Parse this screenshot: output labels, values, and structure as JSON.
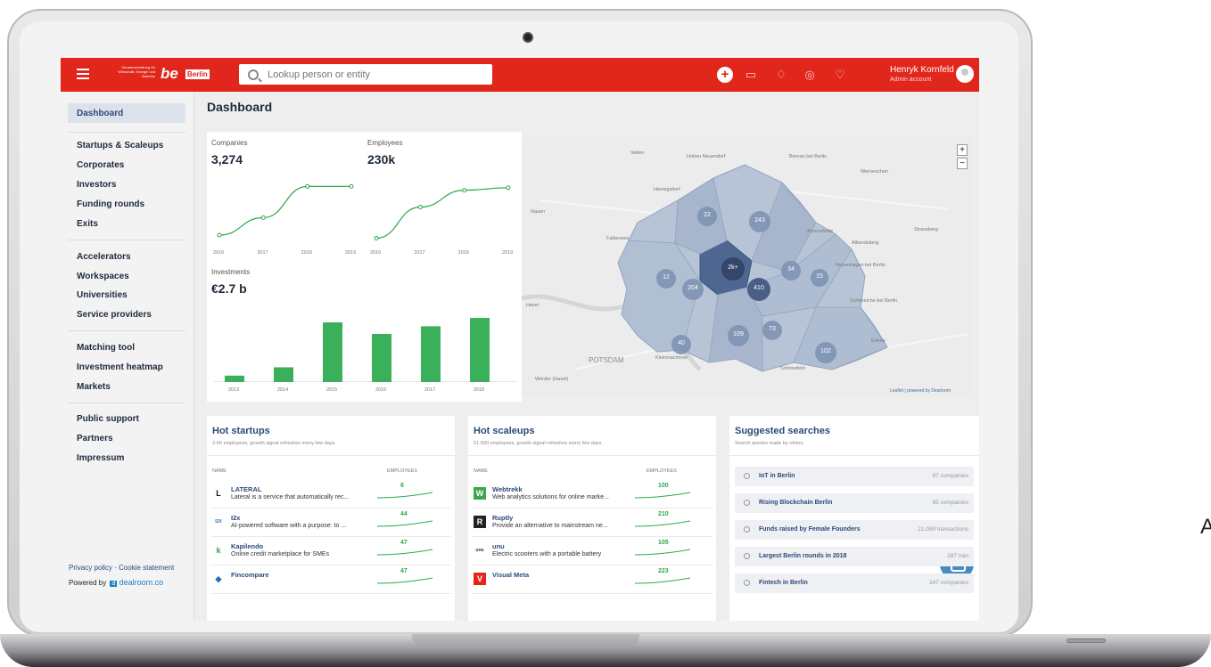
{
  "header": {
    "senate_text": "Senatsverwaltung für Wirtschaft, Energie und Betriebe",
    "logo_be": "be",
    "logo_berlin": "Berlin",
    "search_placeholder": "Lookup person or entity",
    "user_name": "Henryk Kornfeld",
    "user_role": "Admin account",
    "accent_color": "#e1261c"
  },
  "sidebar": {
    "active": "Dashboard",
    "group1": [
      "Startups & Scaleups",
      "Corporates",
      "Investors",
      "Funding rounds",
      "Exits"
    ],
    "group2": [
      "Accelerators",
      "Workspaces",
      "Universities",
      "Service providers"
    ],
    "group3": [
      "Matching tool",
      "Investment heatmap",
      "Markets"
    ],
    "group4": [
      "Public support",
      "Partners",
      "Impressum"
    ],
    "footer_links": "Privacy policy · Cookie statement",
    "powered_by": "Powered by",
    "powered_brand": "dealroom.co"
  },
  "main": {
    "title": "Dashboard",
    "companies": {
      "label": "Companies",
      "value": "3,274"
    },
    "employees": {
      "label": "Employees",
      "value": "230k"
    },
    "investments": {
      "label": "Investments",
      "value": "€2.7 b"
    }
  },
  "chart_data": [
    {
      "type": "line",
      "title": "Companies",
      "x": [
        "2016",
        "2017",
        "2018",
        "2019"
      ],
      "values": [
        0.1,
        0.38,
        0.88,
        0.88
      ],
      "color": "#2aa84a"
    },
    {
      "type": "line",
      "title": "Employees",
      "x": [
        "2016",
        "2017",
        "2018",
        "2019"
      ],
      "values": [
        0.05,
        0.55,
        0.82,
        0.86
      ],
      "color": "#2aa84a"
    },
    {
      "type": "bar",
      "title": "Investments",
      "categories": [
        "2013",
        "2014",
        "2015",
        "2016",
        "2017",
        "2018"
      ],
      "values": [
        0.1,
        0.23,
        0.93,
        0.75,
        0.87,
        1.0
      ],
      "color": "#3bb05a"
    }
  ],
  "map": {
    "clusters": [
      "22",
      "243",
      "2k+",
      "34",
      "15",
      "12",
      "204",
      "410",
      "109",
      "73",
      "40",
      "102"
    ],
    "place_labels": [
      "Velten",
      "Hohen Neuendorf",
      "Bernau bei Berlin",
      "Hennigsdorf",
      "Werneuchen",
      "Nauen",
      "Falkensee",
      "Ahrensfelde",
      "Altlandsberg",
      "Strausberg",
      "Neuenhagen bei Berlin",
      "Schöneiche bei Berlin",
      "Havel",
      "POTSDAM",
      "Kleinmachnow",
      "Schönefeld",
      "Werder (Havel)",
      "Erkner"
    ],
    "attribution": "Leaflet | powered by Dealroom",
    "zoom_in": "+",
    "zoom_out": "−"
  },
  "hot_startups": {
    "title": "Hot startups",
    "subtitle": "2-50 employees, growth signal refreshes every few days.",
    "col_name": "NAME",
    "col_employees": "EMPLOYEES",
    "rows": [
      {
        "logo": "L",
        "name": "LATERAL",
        "desc": "Lateral is a service that automatically rec...",
        "employees": "6"
      },
      {
        "logo": "I2X",
        "name": "I2x",
        "desc": "AI-powered software with a purpose: to ...",
        "employees": "44"
      },
      {
        "logo": "k",
        "name": "Kapilendo",
        "desc": "Online credit marketplace for SMEs",
        "employees": "47"
      },
      {
        "logo": "◆",
        "name": "Fincompare",
        "desc": "",
        "employees": "47"
      }
    ]
  },
  "hot_scaleups": {
    "title": "Hot scaleups",
    "subtitle": "51-500 employees, growth signal refreshes every few days.",
    "col_name": "NAME",
    "col_employees": "EMPLOYEES",
    "rows": [
      {
        "logo": "W",
        "name": "Webtrekk",
        "desc": "Web analytics solutions for online marke...",
        "employees": "100"
      },
      {
        "logo": "R",
        "name": "Ruptly",
        "desc": "Provide an alternative to mainstream ne...",
        "employees": "210"
      },
      {
        "logo": "unu",
        "name": "unu",
        "desc": "Electric scooters with a portable battery",
        "employees": "105"
      },
      {
        "logo": "V",
        "name": "Visual Meta",
        "desc": "",
        "employees": "223"
      }
    ]
  },
  "suggested": {
    "title": "Suggested searches",
    "subtitle": "Search queries made by others.",
    "rows": [
      {
        "label": "IoT in Berlin",
        "count": "97 companies"
      },
      {
        "label": "Rising Blockchain Berlin",
        "count": "85 companies"
      },
      {
        "label": "Funds raised by Female Founders",
        "count": "21,099 transactions"
      },
      {
        "label": "Largest Berlin rounds in 2018",
        "count": "287 tran"
      },
      {
        "label": "Fintech in Berlin",
        "count": "347 companies"
      }
    ]
  },
  "outside_letter": "A"
}
